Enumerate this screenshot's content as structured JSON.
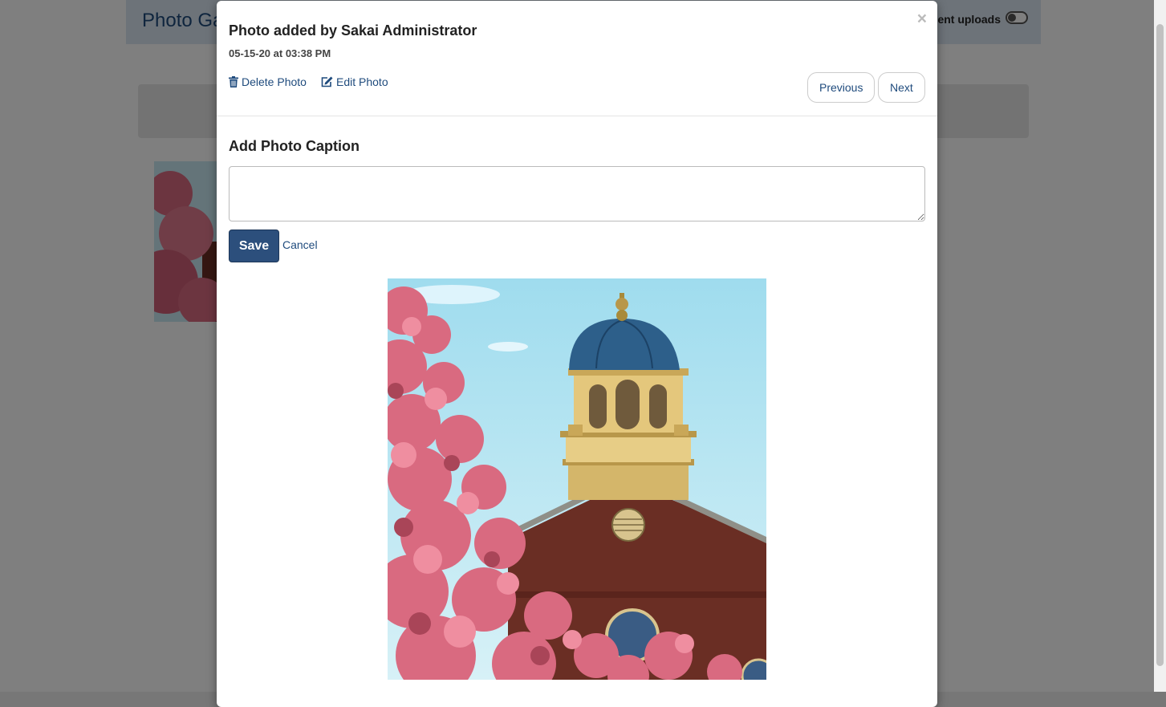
{
  "background_page": {
    "title": "Photo Ga",
    "toggle_label": "ent uploads"
  },
  "modal": {
    "title": "Photo added by Sakai Administrator",
    "date": "05-15-20 at 03:38 PM",
    "close_symbol": "×",
    "actions": {
      "delete_label": "Delete Photo",
      "edit_label": "Edit Photo"
    },
    "nav": {
      "previous_label": "Previous",
      "next_label": "Next"
    },
    "caption": {
      "heading": "Add Photo Caption",
      "value": "",
      "save_label": "Save",
      "cancel_label": "Cancel"
    }
  },
  "colors": {
    "link": "#1f4b7d",
    "primary_button": "#2c4f7c",
    "sky": "#c5eaf4",
    "dome": "#2d5f8a",
    "brick": "#6a2e24",
    "blossom": "#d96a80"
  },
  "icons": [
    "trash-icon",
    "edit-icon",
    "close-icon"
  ]
}
